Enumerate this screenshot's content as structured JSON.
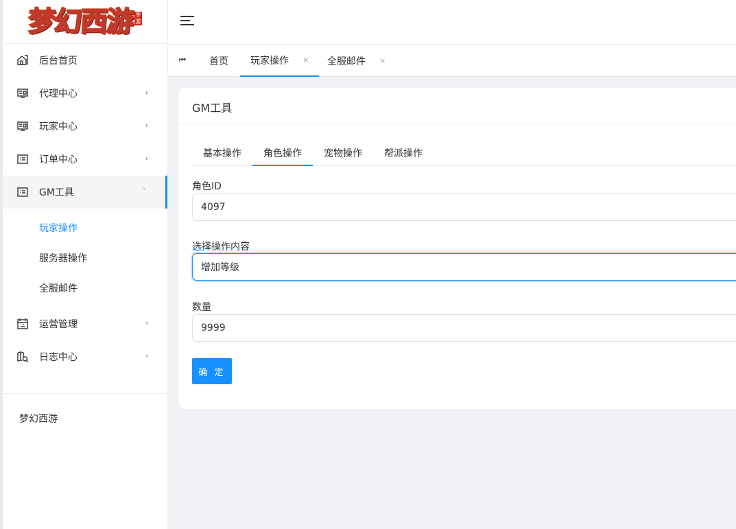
{
  "logo": {
    "text": "梦幻西游",
    "seal": "手游"
  },
  "sidebar": {
    "items": [
      {
        "label": "后台首页",
        "icon": "home-icon"
      },
      {
        "label": "代理中心",
        "icon": "monitor-icon"
      },
      {
        "label": "玩家中心",
        "icon": "monitor-icon"
      },
      {
        "label": "订单中心",
        "icon": "list-icon"
      },
      {
        "label": "GM工具",
        "icon": "list-icon"
      },
      {
        "label": "运营管理",
        "icon": "calendar-icon"
      },
      {
        "label": "日志中心",
        "icon": "map-search-icon"
      }
    ],
    "gm_subitems": [
      {
        "label": "玩家操作"
      },
      {
        "label": "服务器操作"
      },
      {
        "label": "全服邮件"
      }
    ],
    "footer": "梦幻西游"
  },
  "tabs": {
    "first_icon": "⏮",
    "items": [
      {
        "label": "首页"
      },
      {
        "label": "玩家操作",
        "close": "×"
      },
      {
        "label": "全服邮件",
        "close": "×"
      }
    ]
  },
  "card": {
    "title": "GM工具",
    "sub_tabs": [
      {
        "label": "基本操作"
      },
      {
        "label": "角色操作"
      },
      {
        "label": "宠物操作"
      },
      {
        "label": "帮派操作"
      }
    ],
    "fields": {
      "role_id_label": "角色ID",
      "role_id_value": "4097",
      "operation_label": "选择操作内容",
      "operation_value": "增加等级",
      "quantity_label": "数量",
      "quantity_value": "9999"
    },
    "confirm_label": "确 定"
  },
  "colors": {
    "accent": "#1890ff",
    "bg": "#f0f2f5"
  }
}
